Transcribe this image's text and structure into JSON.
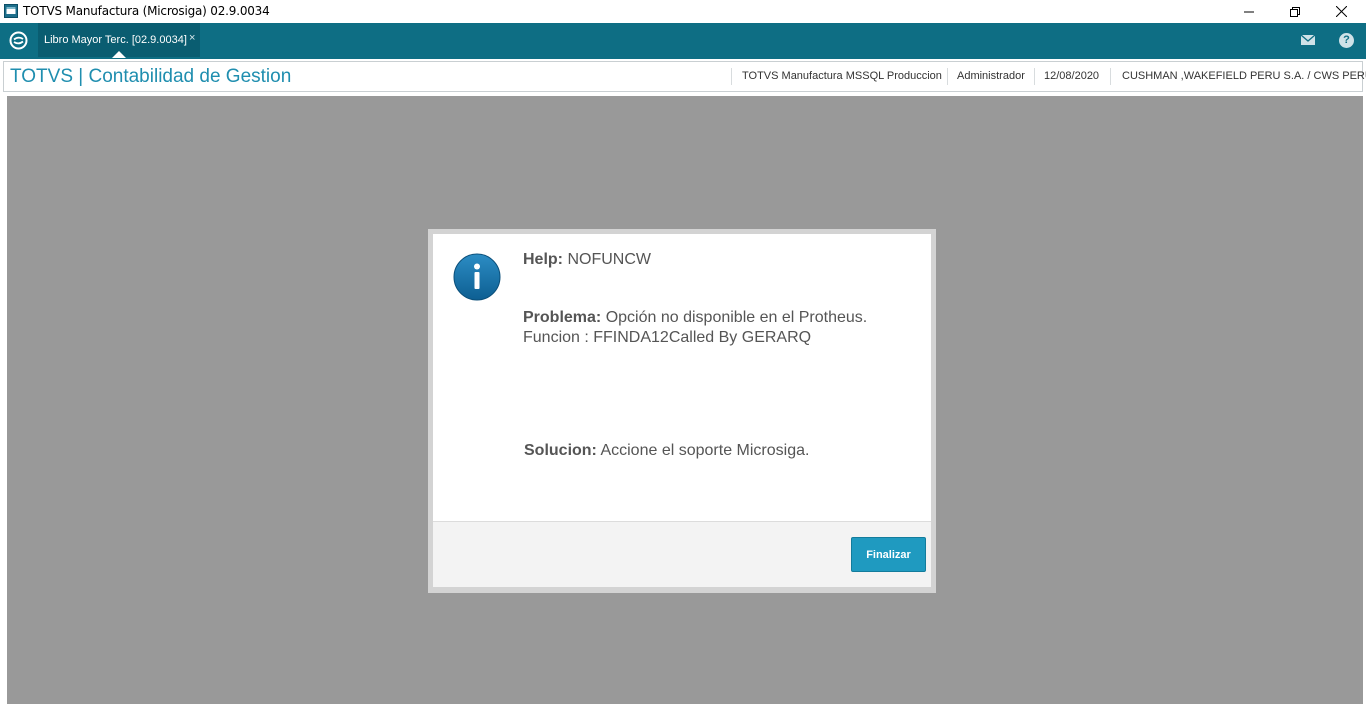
{
  "window": {
    "title": "TOTVS Manufactura (Microsiga) 02.9.0034"
  },
  "tab": {
    "label": "Libro Mayor Terc. [02.9.0034]",
    "close": "×"
  },
  "module": {
    "title": "TOTVS | Contabilidad de Gestion",
    "environment": "TOTVS Manufactura MSSQL Produccion",
    "user": "Administrador",
    "date": "12/08/2020",
    "company": "CUSHMAN ,WAKEFIELD PERU S.A. / CWS PERU"
  },
  "dialog": {
    "help_label": "Help:",
    "help_code": "NOFUNCW",
    "problem_label": "Problema:",
    "problem_text": "Opción no disponible en el Protheus.",
    "problem_detail": "Funcion : FFINDA12Called By GERARQ",
    "solution_label": "Solucion:",
    "solution_text": "Accione el soporte Microsiga.",
    "button_label": "Finalizar"
  },
  "icons": {
    "app": "window-app-icon",
    "logo": "totvs-logo-icon",
    "mail": "mail-icon",
    "help": "help-icon",
    "info": "info-icon"
  },
  "colors": {
    "appbar": "#0e6e84",
    "title_accent": "#1f8eaf",
    "button": "#1f9ac0",
    "overlay": "#999999"
  }
}
